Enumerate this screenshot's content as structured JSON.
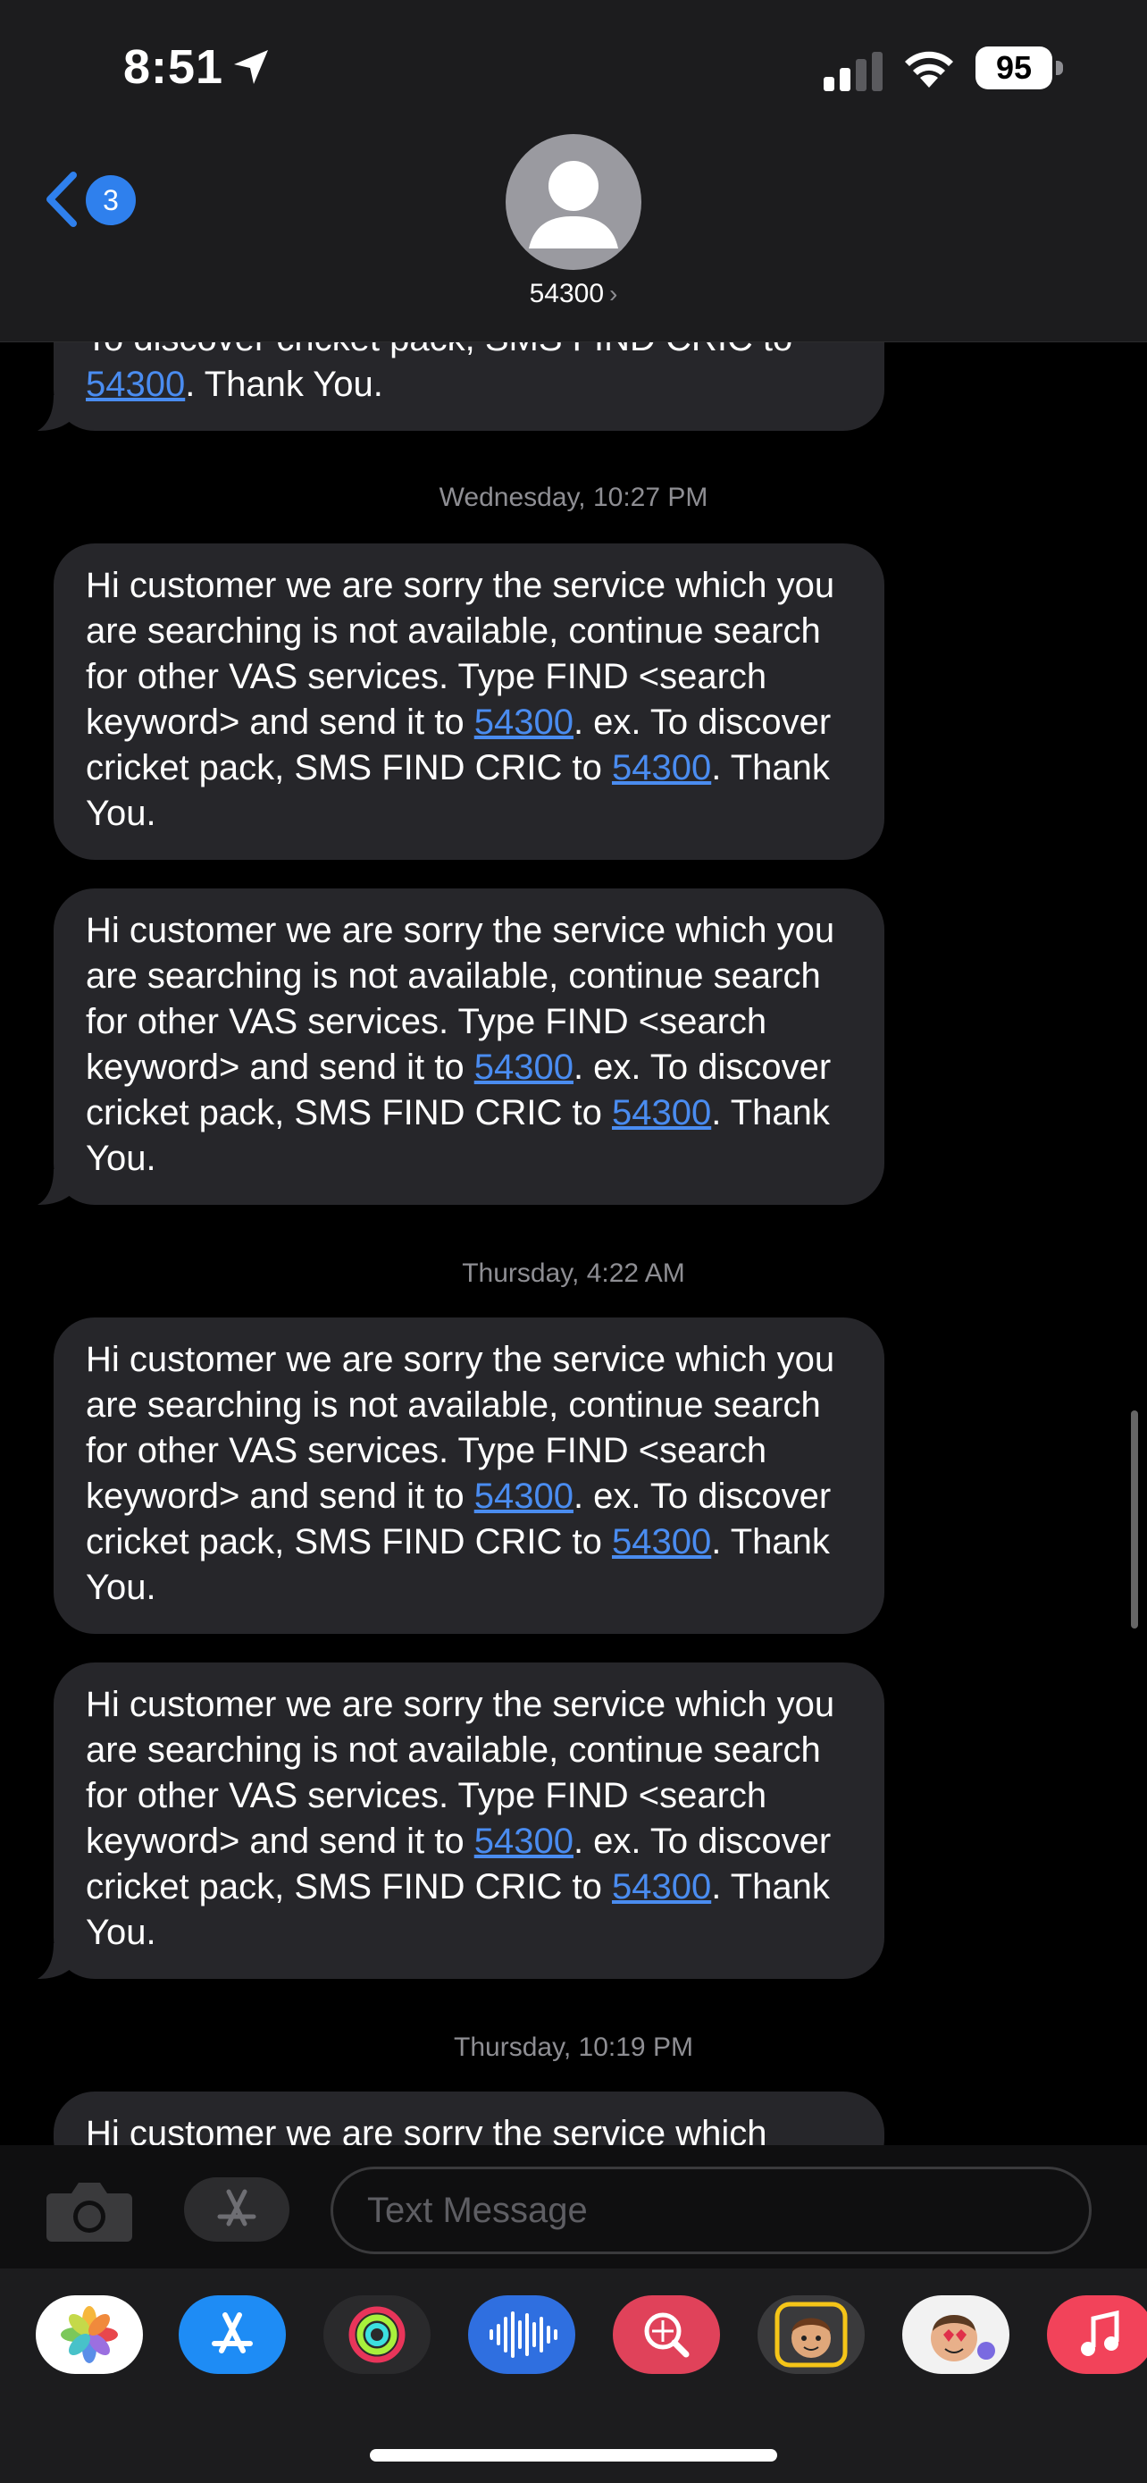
{
  "status_bar": {
    "time": "8:51",
    "battery": "95"
  },
  "header": {
    "back_badge": "3",
    "contact_name": "54300",
    "chevron": "›"
  },
  "thread": {
    "timestamps": [
      "Wednesday, 10:27 PM",
      "Thursday, 4:22 AM",
      "Thursday, 10:19 PM"
    ],
    "partial_top": {
      "line1": "To discover cricket pack, SMS FIND CRIC to",
      "link": "54300",
      "tail": ". Thank You."
    },
    "message": {
      "text_a": "Hi customer we are sorry the service which you are searching is not available, continue search for other VAS services. Type FIND <search keyword> and send it to ",
      "link": "54300",
      "text_b": ". ex. To discover cricket pack, SMS FIND CRIC to ",
      "text_c": ". Thank You."
    },
    "partial_bottom": "Hi customer we are sorry the service which"
  },
  "compose": {
    "placeholder": "Text Message"
  },
  "app_drawer": {
    "apps": [
      "photos-icon",
      "app-store-icon",
      "fitness-icon",
      "voice-memos-icon",
      "image-search-icon",
      "memoji-icon",
      "memoji-stickers-icon",
      "music-icon"
    ]
  },
  "colors": {
    "bubble": "#26262a",
    "link": "#4a8cf0",
    "badge": "#2f80ed",
    "background": "#000000"
  }
}
